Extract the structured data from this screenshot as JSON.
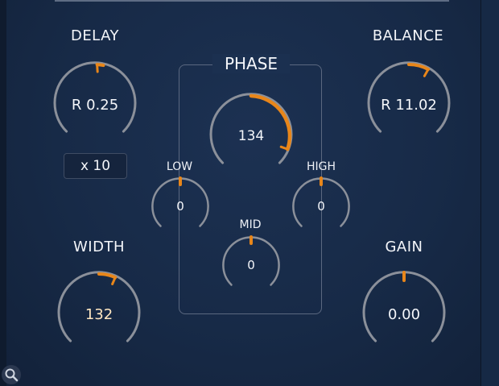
{
  "labels": {
    "delay": "DELAY",
    "balance": "BALANCE",
    "phase": "PHASE",
    "low": "LOW",
    "high": "HIGH",
    "mid": "MID",
    "width": "WIDTH",
    "gain": "GAIN"
  },
  "knobs": {
    "delay": {
      "value": "R 0.25"
    },
    "balance": {
      "value": "R 11.02"
    },
    "phase": {
      "value": "134"
    },
    "low": {
      "value": "0"
    },
    "high": {
      "value": "0"
    },
    "mid": {
      "value": "0"
    },
    "width": {
      "value": "132"
    },
    "gain": {
      "value": "0.00"
    }
  },
  "multiplier": {
    "label": "x 10"
  },
  "colors": {
    "accent": "#e8861a",
    "ring": "#8b909a",
    "background": "#172a47",
    "highlight_value": "#ffe7c2"
  },
  "icons": {
    "search": "magnifier-icon"
  }
}
